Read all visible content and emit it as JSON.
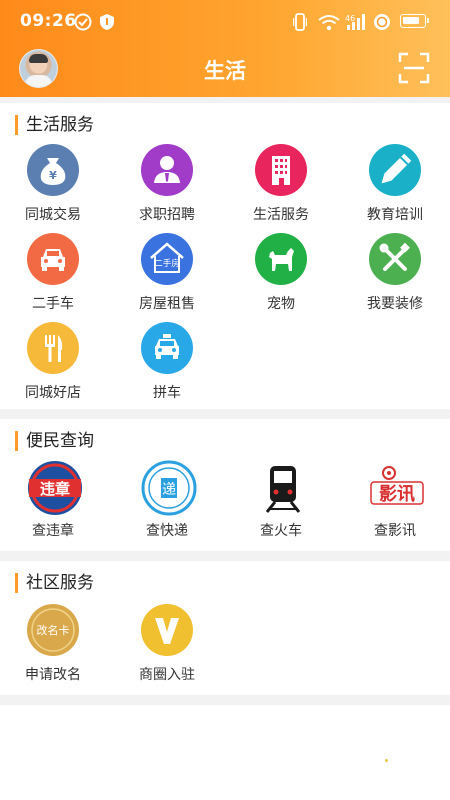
{
  "status": {
    "time": "09:26",
    "battery_level": 0.85
  },
  "header": {
    "title": "生活"
  },
  "life_services": {
    "title": "生活服务",
    "items": [
      {
        "label": "同城交易",
        "icon": "money-bag-icon",
        "color": "#5b7fb0",
        "glyph": "¥"
      },
      {
        "label": "求职招聘",
        "icon": "job-person-icon",
        "color": "#a03cc8"
      },
      {
        "label": "生活服务",
        "icon": "building-icon",
        "color": "#e8255c"
      },
      {
        "label": "教育培训",
        "icon": "pencil-icon",
        "color": "#1ab0c8"
      },
      {
        "label": "二手车",
        "icon": "car-icon",
        "color": "#f26a44"
      },
      {
        "label": "房屋租售",
        "icon": "house-icon",
        "color": "#3a73e0",
        "glyph": "二手房"
      },
      {
        "label": "宠物",
        "icon": "dog-icon",
        "color": "#20b046"
      },
      {
        "label": "我要装修",
        "icon": "tools-icon",
        "color": "#4caf50"
      },
      {
        "label": "同城好店",
        "icon": "fork-knife-icon",
        "color": "#f6b93a"
      },
      {
        "label": "拼车",
        "icon": "taxi-icon",
        "color": "#29a8e8"
      }
    ]
  },
  "convenience": {
    "title": "便民查询",
    "items": [
      {
        "label": "查违章",
        "icon": "violation-icon",
        "glyph": "违章"
      },
      {
        "label": "查快递",
        "icon": "express-icon",
        "glyph": "递"
      },
      {
        "label": "查火车",
        "icon": "train-icon"
      },
      {
        "label": "查影讯",
        "icon": "movie-icon",
        "glyph": "影讯"
      }
    ]
  },
  "community": {
    "title": "社区服务",
    "items": [
      {
        "label": "申请改名",
        "icon": "rename-card-icon",
        "color": "#d9a84a",
        "glyph": "改名卡"
      },
      {
        "label": "商圈入驻",
        "icon": "v-icon",
        "color": "#f0c030",
        "glyph": "V"
      }
    ]
  }
}
